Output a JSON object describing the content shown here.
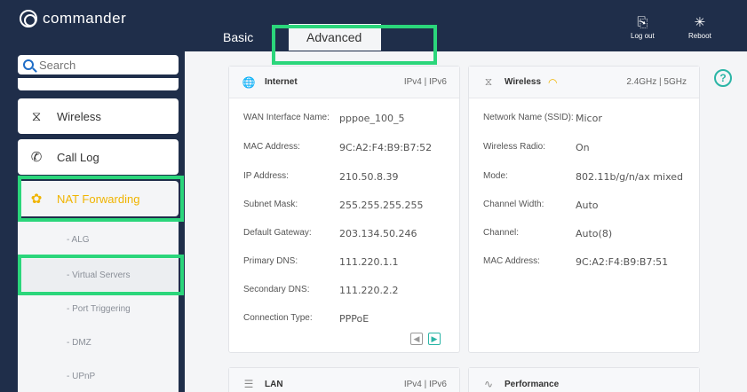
{
  "app": {
    "logo_text": "commander"
  },
  "search": {
    "placeholder": "Search"
  },
  "sidebar": {
    "items": [
      {
        "label": "Wireless",
        "icon": "wifi-icon"
      },
      {
        "label": "Call Log",
        "icon": "phone-icon"
      },
      {
        "label": "NAT Forwarding",
        "icon": "nat-icon",
        "active": true
      }
    ],
    "subitems": [
      {
        "label": "- ALG"
      },
      {
        "label": "- Virtual Servers",
        "active": true
      },
      {
        "label": "- Port Triggering"
      },
      {
        "label": "- DMZ"
      },
      {
        "label": "- UPnP"
      }
    ]
  },
  "tabs": [
    {
      "label": "Basic"
    },
    {
      "label": "Advanced",
      "active": true
    }
  ],
  "header": {
    "logout_label": "Log out",
    "reboot_label": "Reboot"
  },
  "internet": {
    "title": "Internet",
    "ip_versions": "IPv4 | IPv6",
    "rows": [
      {
        "label": "WAN Interface Name:",
        "value": "pppoe_100_5"
      },
      {
        "label": "MAC Address:",
        "value": "9C:A2:F4:B9:B7:52"
      },
      {
        "label": "IP Address:",
        "value": "210.50.8.39"
      },
      {
        "label": "Subnet Mask:",
        "value": "255.255.255.255"
      },
      {
        "label": "Default Gateway:",
        "value": "203.134.50.246"
      },
      {
        "label": "Primary DNS:",
        "value": "111.220.1.1"
      },
      {
        "label": "Secondary DNS:",
        "value": "111.220.2.2"
      },
      {
        "label": "Connection Type:",
        "value": "PPPoE"
      }
    ]
  },
  "wireless": {
    "title": "Wireless",
    "bands": "2.4GHz | 5GHz",
    "rows": [
      {
        "label": "Network Name (SSID):",
        "value": "Micor"
      },
      {
        "label": "Wireless Radio:",
        "value": "On"
      },
      {
        "label": "Mode:",
        "value": "802.11b/g/n/ax mixed"
      },
      {
        "label": "Channel Width:",
        "value": "Auto"
      },
      {
        "label": "Channel:",
        "value": "Auto(8)"
      },
      {
        "label": "MAC Address:",
        "value": "9C:A2:F4:B9:B7:51"
      }
    ]
  },
  "lan": {
    "title": "LAN",
    "ip_versions": "IPv4 | IPv6"
  },
  "performance": {
    "title": "Performance"
  },
  "colors": {
    "accent": "#2bd67b",
    "brand_bg": "#1f2e4a",
    "active_nav": "#f0b400",
    "teal": "#2bb5a6"
  }
}
